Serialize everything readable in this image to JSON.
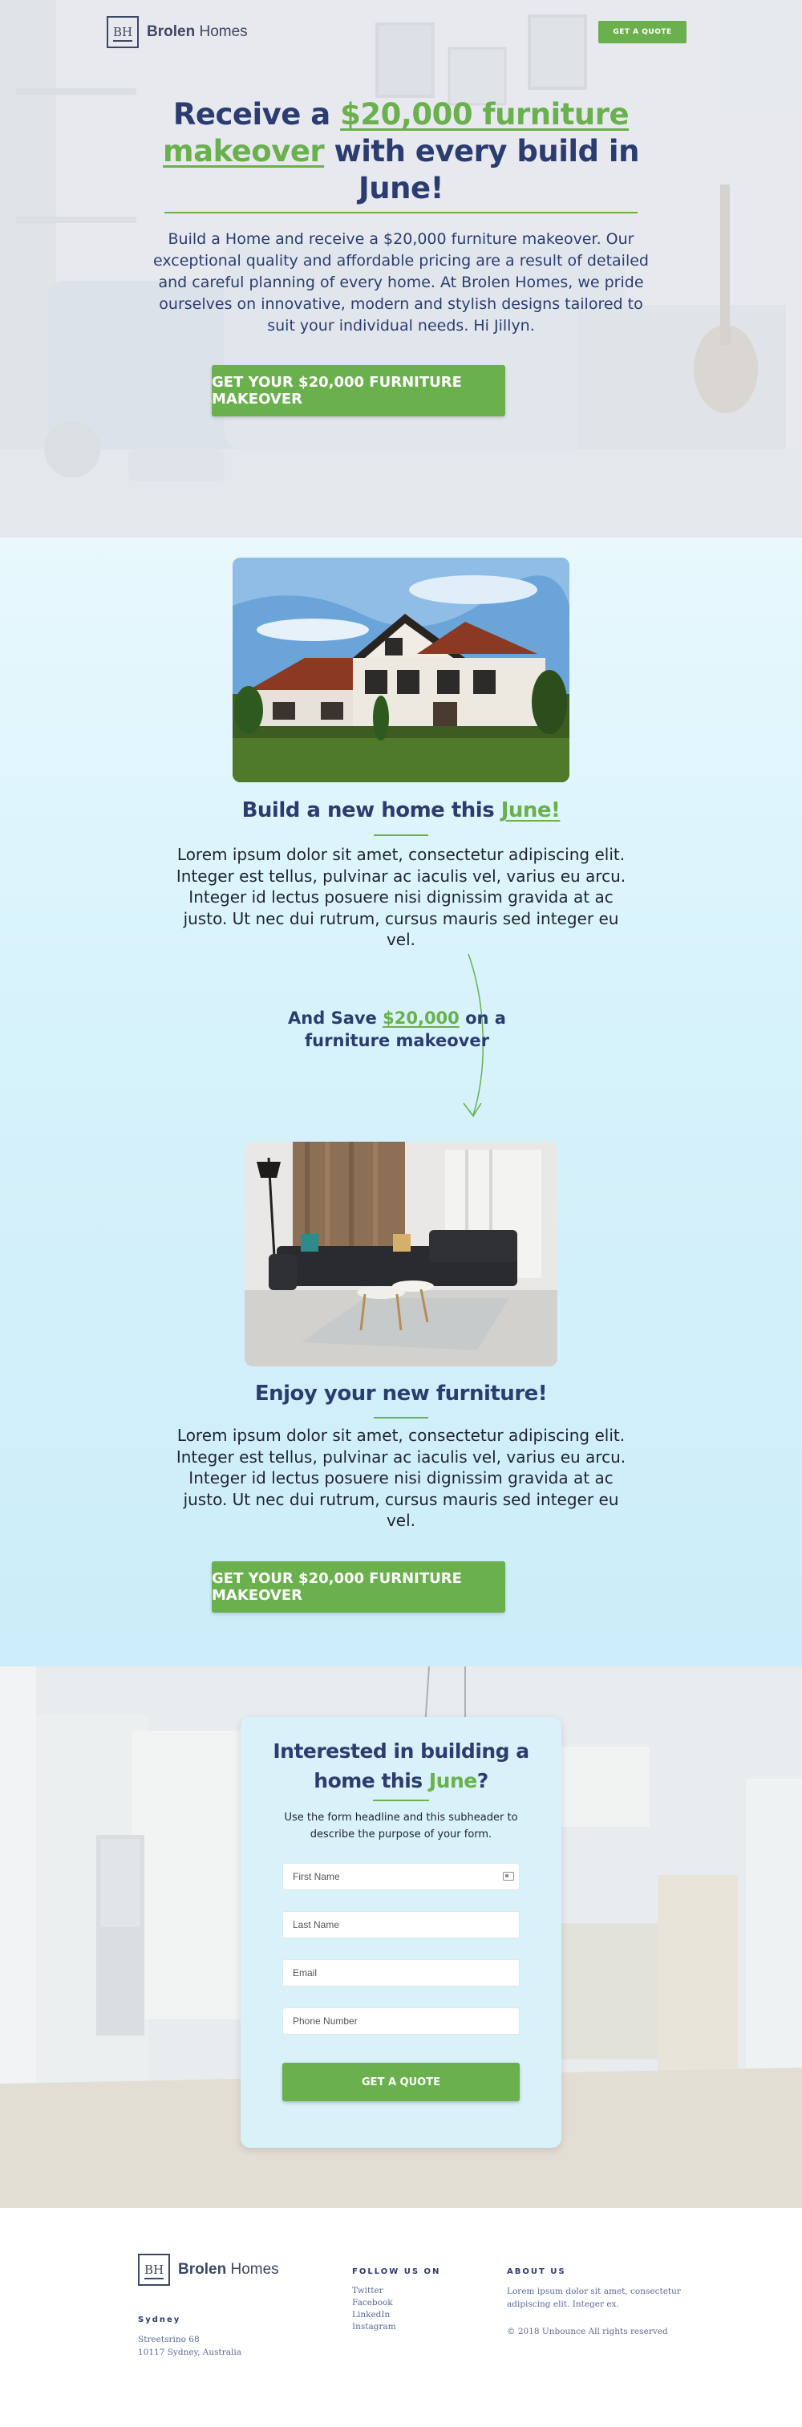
{
  "brand": {
    "mono": "BH",
    "name_bold": "Brolen",
    "name_light": " Homes"
  },
  "header": {
    "cta_label": "GET A QUOTE"
  },
  "hero": {
    "title_pre": "Receive a ",
    "title_highlight": "$20,000 furniture makeover",
    "title_post": " with every build in June!",
    "subtitle": "Build a Home and receive a $20,000 furniture makeover. Our exceptional quality and affordable pricing are a result of detailed and careful planning of every home. At Brolen Homes, we pride ourselves on innovative, modern and stylish designs tailored to suit your individual needs. Hi Jillyn.",
    "cta_label": "GET YOUR $20,000 FURNITURE MAKEOVER"
  },
  "build": {
    "heading_pre": "Build a new home this ",
    "heading_highlight": "June!",
    "body": "Lorem ipsum dolor sit amet, consectetur adipiscing elit. Integer est tellus, pulvinar ac iaculis vel, varius eu arcu. Integer id lectus posuere nisi dignissim gravida at ac justo. Ut nec dui rutrum, cursus mauris sed integer eu vel."
  },
  "save": {
    "pre": "And Save ",
    "amount": "$20,000",
    "post": " on a furniture makeover"
  },
  "enjoy": {
    "heading": "Enjoy your new furniture!",
    "body": "Lorem ipsum dolor sit amet, consectetur adipiscing elit. Integer est tellus, pulvinar ac iaculis vel, varius eu arcu. Integer id lectus posuere nisi dignissim gravida at ac justo. Ut nec dui rutrum, cursus mauris sed integer eu vel.",
    "cta_label": "GET YOUR $20,000 FURNITURE MAKEOVER"
  },
  "form": {
    "title_pre": "Interested in building a home this ",
    "title_highlight": "June",
    "title_post": "?",
    "subtitle": "Use the form headline and this subheader to describe the purpose of your form.",
    "fields": [
      {
        "placeholder": "First Name"
      },
      {
        "placeholder": "Last Name"
      },
      {
        "placeholder": "Email"
      },
      {
        "placeholder": "Phone Number"
      }
    ],
    "submit_label": "GET A QUOTE"
  },
  "footer": {
    "city": "Sydney",
    "address_line1": "Streetsrino 68",
    "address_line2": "10117 Sydney, Australia",
    "follow_heading": "FOLLOW US ON",
    "social": [
      "Twitter",
      "Facebook",
      "LinkedIn",
      "Instagram"
    ],
    "about_heading": "ABOUT US",
    "about_text": "Lorem ipsum dolor sit amet, consectetur adipiscing elit. Integer ex.",
    "copyright": "© 2018 Unbounce All rights reserved"
  },
  "colors": {
    "accent": "#6ab04c",
    "navy": "#2b3d70",
    "section_blue": "#d6f2fb"
  }
}
